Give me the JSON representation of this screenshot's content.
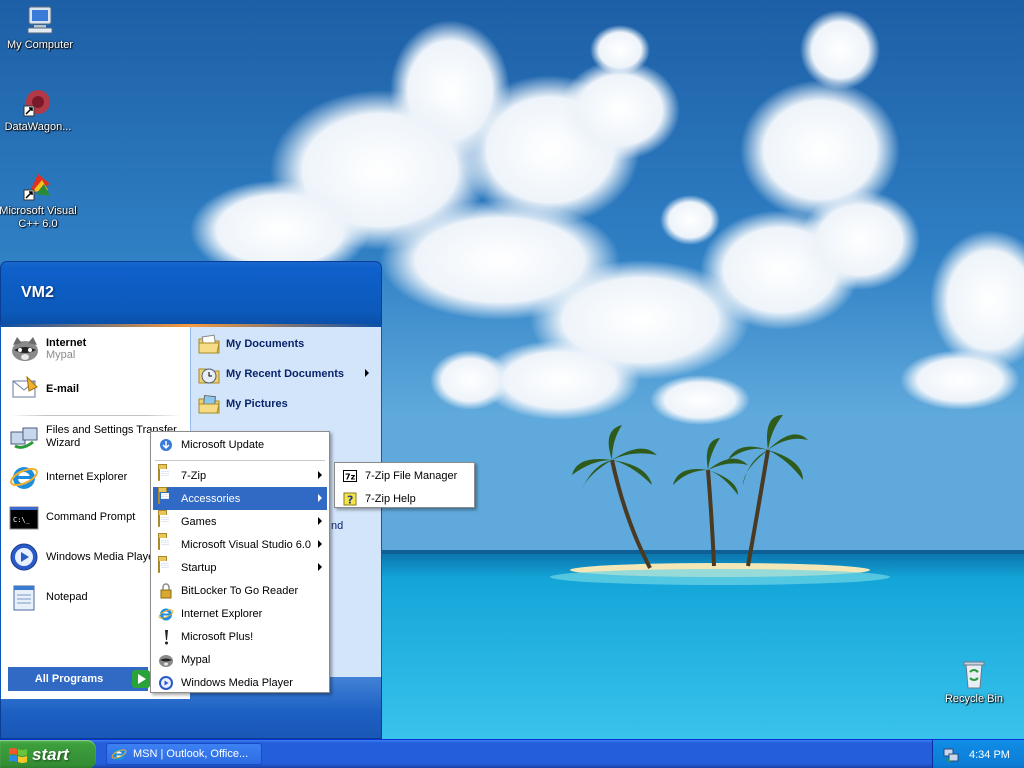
{
  "desktop": {
    "icons": [
      {
        "label": "My Computer",
        "icon": "my-computer-icon"
      },
      {
        "label": "DataWagon...",
        "icon": "datawagon-icon"
      },
      {
        "label": "Microsoft Visual C++ 6.0",
        "icon": "visual-cpp-icon"
      },
      {
        "label": "Recycle Bin",
        "icon": "recycle-bin-icon"
      }
    ]
  },
  "start_menu": {
    "user": "VM2",
    "pinned": [
      {
        "title": "Internet",
        "subtitle": "Mypal",
        "icon": "mypal-raccoon-icon"
      },
      {
        "title": "E-mail",
        "subtitle": "",
        "icon": "email-icon"
      }
    ],
    "recent": [
      {
        "label": "Files and Settings Transfer Wizard",
        "icon": "transfer-wizard-icon"
      },
      {
        "label": "Internet Explorer",
        "icon": "internet-explorer-icon"
      },
      {
        "label": "Command Prompt",
        "icon": "command-prompt-icon"
      },
      {
        "label": "Windows Media Player",
        "icon": "media-player-icon"
      },
      {
        "label": "Notepad",
        "icon": "notepad-icon"
      }
    ],
    "right": [
      {
        "label": "My Documents",
        "icon": "documents-folder-icon"
      },
      {
        "label": "My Recent Documents",
        "icon": "recent-documents-icon"
      },
      {
        "label": "My Pictures",
        "icon": "pictures-folder-icon"
      }
    ],
    "right_partial_text": "nd",
    "all_programs": "All Programs"
  },
  "programs_menu": {
    "items": [
      {
        "label": "Microsoft Update",
        "icon": "microsoft-update-icon",
        "submenu": false
      },
      {
        "label": "7-Zip",
        "icon": "folder-icon",
        "submenu": true
      },
      {
        "label": "Accessories",
        "icon": "folder-icon",
        "submenu": true,
        "highlighted": true
      },
      {
        "label": "Games",
        "icon": "folder-icon",
        "submenu": true
      },
      {
        "label": "Microsoft Visual Studio 6.0",
        "icon": "folder-icon",
        "submenu": true
      },
      {
        "label": "Startup",
        "icon": "folder-icon",
        "submenu": true
      },
      {
        "label": "BitLocker To Go Reader",
        "icon": "bitlocker-icon",
        "submenu": false
      },
      {
        "label": "Internet Explorer",
        "icon": "internet-explorer-icon",
        "submenu": false
      },
      {
        "label": "Microsoft Plus!",
        "icon": "microsoft-plus-icon",
        "submenu": false
      },
      {
        "label": "Mypal",
        "icon": "mypal-raccoon-icon",
        "submenu": false
      },
      {
        "label": "Windows Media Player",
        "icon": "media-player-icon",
        "submenu": false
      }
    ]
  },
  "zip_menu": {
    "items": [
      {
        "label": "7-Zip File Manager",
        "icon": "seven-zip-icon"
      },
      {
        "label": "7-Zip Help",
        "icon": "help-icon"
      }
    ]
  },
  "taskbar": {
    "start_label": "start",
    "task_label": "MSN | Outlook, Office...",
    "clock": "4:34 PM"
  },
  "colors": {
    "highlight": "#316ac5",
    "taskbar": "#245edb",
    "start_green": "#3c9f3c",
    "menu_header": "#0c59b9",
    "right_pane": "#d3e5fa"
  }
}
